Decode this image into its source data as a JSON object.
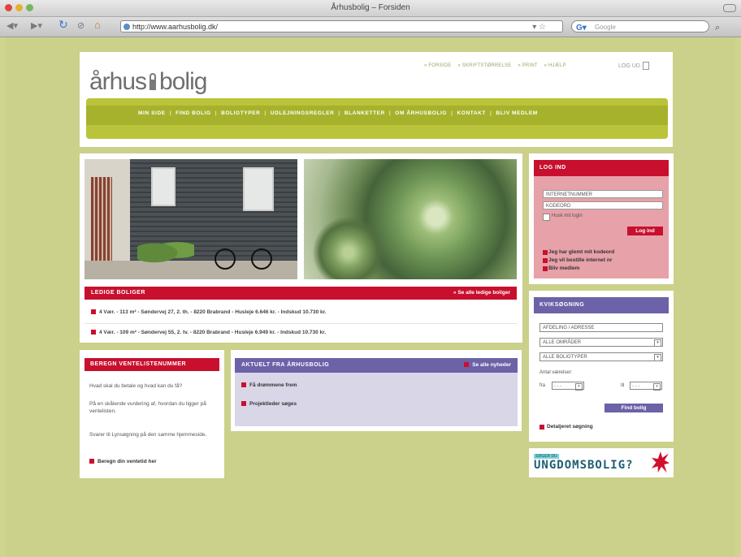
{
  "browser": {
    "title": "Århusbolig – Forsiden",
    "url": "http://www.aarhusbolig.dk/",
    "search_placeholder": "Google"
  },
  "header": {
    "logo_left": "århus",
    "logo_right": "bolig",
    "top_links": [
      "» FORSIDE",
      "» SKRIFTSTØRRELSE",
      "» PRINT",
      "» HJÆLP"
    ],
    "logout": "LOG UD",
    "nav": [
      "MIN SIDE",
      "FIND BOLIG",
      "BOLIGTYPER",
      "UDLEJNINGSREGLER",
      "BLANKETTER",
      "OM ÅRHUSBOLIG",
      "KONTAKT",
      "BLIV MEDLEM"
    ]
  },
  "vacant": {
    "title": "LEDIGE BOLIGER",
    "see_all": "» Se alle ledige boliger",
    "listings": [
      "4 Vær. - 113 m² - Søndervej 27, 2. th. - 8220 Brabrand - Husleje 6.646 kr. - Indskud 10.730 kr.",
      "4 Vær. - 109 m² - Søndervej 55, 2. tv. - 8220 Brabrand - Husleje 6.949 kr. - Indskud 10.730 kr."
    ]
  },
  "queue": {
    "title": "BEREGN VENTELISTENUMMER",
    "text1": "Hvad skal du betale og hvad kan du få?",
    "text2": "På en skålende vurdering af, hvordan du ligger på ventelisten.",
    "text3": "Svarer til Lynsøgning på den samme hjemmeside.",
    "link": "Beregn din ventetid her"
  },
  "news": {
    "title": "AKTUELT FRA ÅRHUSBOLIG",
    "see_all": "Se alle nyheder",
    "items": [
      "Få drømmene frem",
      "Projektleder søges"
    ]
  },
  "login": {
    "title": "LOG IND",
    "user_placeholder": "INTERNETNUMMER",
    "password_placeholder": "KODEORD",
    "remember": "Husk mit login",
    "button": "Log ind",
    "links": [
      "Jeg har glemt mit kodeord",
      "Jeg vil bestille internet nr",
      "Bliv medlem"
    ]
  },
  "quicksearch": {
    "title": "KVIKSØGNING",
    "field1": "AFDELING / ADRESSE",
    "area": "ALLE OMRÅDER",
    "type": "ALLE BOLIGTYPER",
    "rooms_label": "Antal værelser:",
    "from_label": "fra",
    "to_label": "til",
    "from_value": "- - -",
    "to_value": "- - -",
    "button": "Find bolig",
    "detailed": "Detaljeret søgning"
  },
  "banner": {
    "small": "SØGER DU",
    "big": "UNGDOMSBOLIG?"
  }
}
